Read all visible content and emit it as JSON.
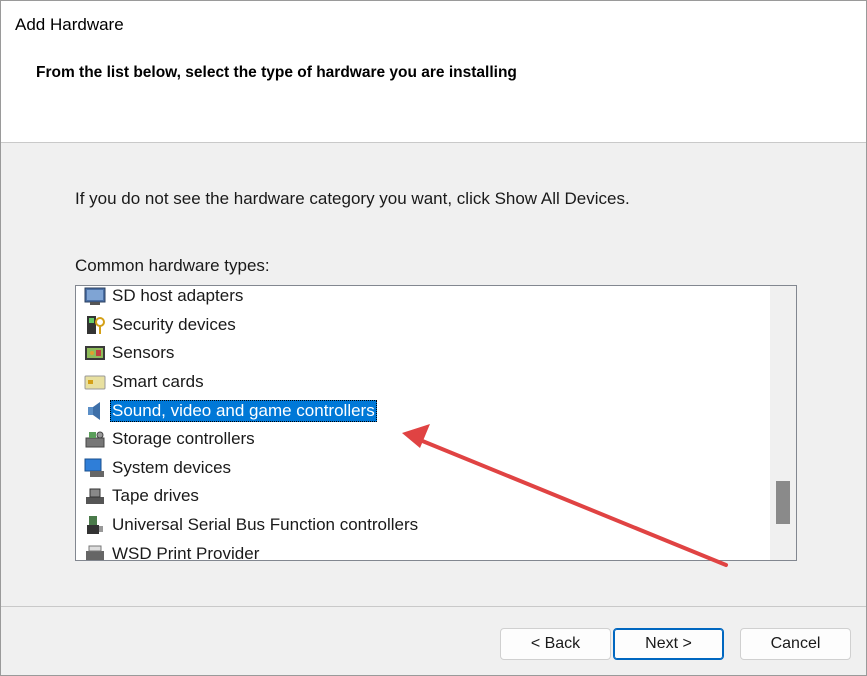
{
  "window": {
    "title": "Add Hardware",
    "subtitle": "From the list below, select the type of hardware you are installing"
  },
  "main": {
    "instruction": "If you do not see the hardware category you want, click Show All Devices.",
    "list_label": "Common hardware types:",
    "items": [
      {
        "label": "SD host adapters",
        "icon": "sd-adapter-icon"
      },
      {
        "label": "Security devices",
        "icon": "security-device-icon"
      },
      {
        "label": "Sensors",
        "icon": "sensor-icon"
      },
      {
        "label": "Smart cards",
        "icon": "smart-card-icon"
      },
      {
        "label": "Sound, video and game controllers",
        "icon": "speaker-icon",
        "selected": true
      },
      {
        "label": "Storage controllers",
        "icon": "storage-controller-icon"
      },
      {
        "label": "System devices",
        "icon": "system-device-icon"
      },
      {
        "label": "Tape drives",
        "icon": "tape-drive-icon"
      },
      {
        "label": "Universal Serial Bus Function controllers",
        "icon": "usb-icon"
      },
      {
        "label": "WSD Print Provider",
        "icon": "printer-icon"
      }
    ]
  },
  "buttons": {
    "back": "< Back",
    "next": "Next >",
    "cancel": "Cancel"
  },
  "colors": {
    "selection": "#0078d7",
    "annotation_arrow": "#e04343"
  }
}
